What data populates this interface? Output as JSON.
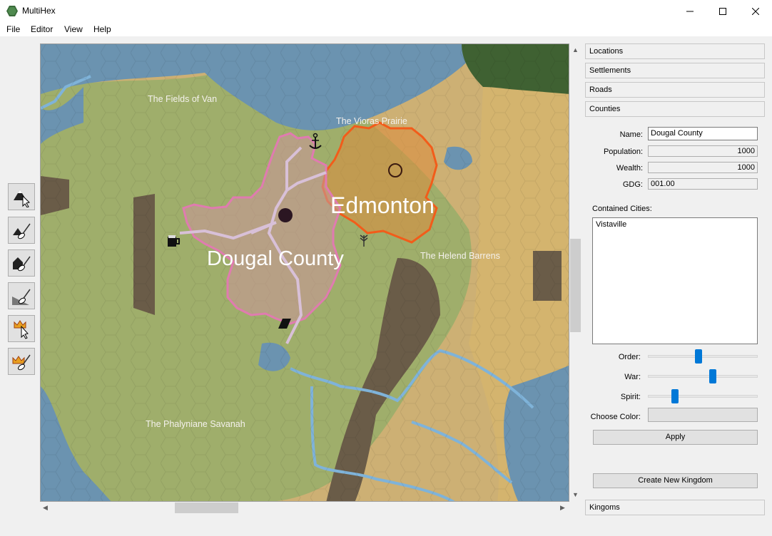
{
  "window": {
    "title": "MultiHex",
    "minimize_icon": "minimize-icon",
    "maximize_icon": "maximize-icon",
    "close_icon": "close-icon"
  },
  "menu": [
    "File",
    "Editor",
    "View",
    "Help"
  ],
  "toolbar": {
    "tools": [
      {
        "name": "select-hex-tool",
        "icon": "mountain-cursor-icon"
      },
      {
        "name": "add-location-tool",
        "icon": "brush-icon"
      },
      {
        "name": "add-settlement-tool",
        "icon": "house-brush-icon"
      },
      {
        "name": "road-tool",
        "icon": "road-brush-icon"
      },
      {
        "name": "county-select-tool",
        "icon": "crown-cursor-icon"
      },
      {
        "name": "county-paint-tool",
        "icon": "crown-brush-icon"
      }
    ]
  },
  "map": {
    "labels": {
      "fields_of_van": "The Fields of Van",
      "vioras_prairie": "The Vioras Prairie",
      "helend_barrens": "The Helend Barrens",
      "phalyniane_savanah": "The Phalyniane Savanah",
      "edmonton": "Edmonton",
      "dougal_county": "Dougal County"
    },
    "colors": {
      "water": "#6b93b0",
      "grass": "#9fae6b",
      "sand": "#cdb074",
      "mountain": "#6a5c48",
      "forest": "#3f6132",
      "county_dougal": "#e07bb0",
      "county_edmonton": "#f25c1a"
    }
  },
  "panel": {
    "sections": [
      "Locations",
      "Settlements",
      "Roads",
      "Counties"
    ],
    "bottom_section": "Kingoms",
    "form": {
      "name_label": "Name:",
      "name_value": "Dougal County",
      "population_label": "Population:",
      "population_value": "1000",
      "wealth_label": "Wealth:",
      "wealth_value": "1000",
      "gdg_label": "GDG:",
      "gdg_value": "001.00",
      "contained_label": "Contained Cities:",
      "cities": [
        "Vistaville"
      ],
      "order_label": "Order:",
      "order_value": 0.46,
      "war_label": "War:",
      "war_value": 0.6,
      "spirit_label": "Spirit:",
      "spirit_value": 0.23,
      "color_label": "Choose Color:",
      "apply_button": "Apply",
      "create_kingdom_button": "Create New Kingdom"
    }
  }
}
